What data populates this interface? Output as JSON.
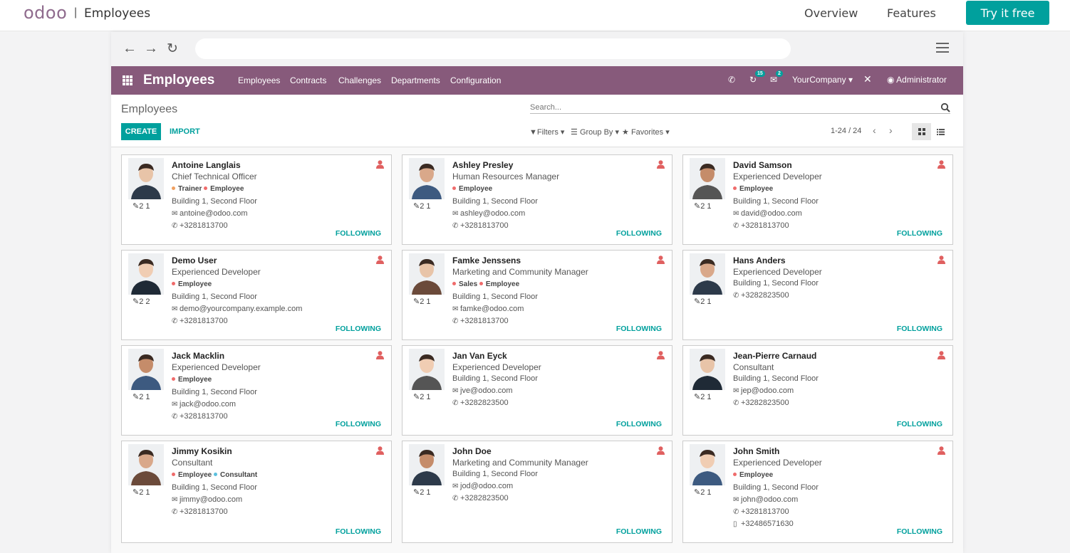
{
  "site": {
    "logo": "odoo",
    "separator": "|",
    "title": "Employees",
    "nav": [
      "Overview",
      "Features"
    ],
    "cta": "Try it free"
  },
  "app": {
    "brand": "Employees",
    "menu": [
      "Employees",
      "Contracts",
      "Challenges",
      "Departments",
      "Configuration"
    ],
    "activity_badge": "15",
    "messages_badge": "2",
    "company": "YourCompany",
    "user": "Administrator",
    "accent": "#875a7b",
    "primary": "#00a09d"
  },
  "control": {
    "breadcrumb": "Employees",
    "search_placeholder": "Search...",
    "create": "CREATE",
    "import": "IMPORT",
    "filters": "Filters",
    "group_by": "Group By",
    "favorites": "Favorites",
    "pager": "1-24 / 24"
  },
  "following_label": "FOLLOWING",
  "employees": [
    {
      "name": "Antoine Langlais",
      "job": "Chief Technical Officer",
      "tags": [
        {
          "label": "Trainer",
          "color": "#f0a060"
        },
        {
          "label": "Employee",
          "color": "#ef6b6b"
        }
      ],
      "location": "Building 1, Second Floor",
      "email": "antoine@odoo.com",
      "phone": "+3281813700",
      "mobile": "",
      "stats": "2  1"
    },
    {
      "name": "Ashley Presley",
      "job": "Human Resources Manager",
      "tags": [
        {
          "label": "Employee",
          "color": "#ef6b6b"
        }
      ],
      "location": "Building 1, Second Floor",
      "email": "ashley@odoo.com",
      "phone": "+3281813700",
      "mobile": "",
      "stats": "2  1"
    },
    {
      "name": "David Samson",
      "job": "Experienced Developer",
      "tags": [
        {
          "label": "Employee",
          "color": "#ef6b6b"
        }
      ],
      "location": "Building 1, Second Floor",
      "email": "david@odoo.com",
      "phone": "+3281813700",
      "mobile": "",
      "stats": "2  1"
    },
    {
      "name": "Demo User",
      "job": "Experienced Developer",
      "tags": [
        {
          "label": "Employee",
          "color": "#ef6b6b"
        }
      ],
      "location": "Building 1, Second Floor",
      "email": "demo@yourcompany.example.com",
      "phone": "+3281813700",
      "mobile": "",
      "stats": "2  2"
    },
    {
      "name": "Famke Jenssens",
      "job": "Marketing and Community Manager",
      "tags": [
        {
          "label": "Sales",
          "color": "#ef6b6b"
        },
        {
          "label": "Employee",
          "color": "#ef6b6b"
        }
      ],
      "location": "Building 1, Second Floor",
      "email": "famke@odoo.com",
      "phone": "+3281813700",
      "mobile": "",
      "stats": "2  1"
    },
    {
      "name": "Hans Anders",
      "job": "Experienced Developer",
      "tags": [],
      "location": "Building 1, Second Floor",
      "email": "",
      "phone": "+3282823500",
      "mobile": "",
      "stats": "2  1"
    },
    {
      "name": "Jack Macklin",
      "job": "Experienced Developer",
      "tags": [
        {
          "label": "Employee",
          "color": "#ef6b6b"
        }
      ],
      "location": "Building 1, Second Floor",
      "email": "jack@odoo.com",
      "phone": "+3281813700",
      "mobile": "",
      "stats": "2  1"
    },
    {
      "name": "Jan Van Eyck",
      "job": "Experienced Developer",
      "tags": [],
      "location": "Building 1, Second Floor",
      "email": "jve@odoo.com",
      "phone": "+3282823500",
      "mobile": "",
      "stats": "2  1"
    },
    {
      "name": "Jean-Pierre Carnaud",
      "job": "Consultant",
      "tags": [],
      "location": "Building 1, Second Floor",
      "email": "jep@odoo.com",
      "phone": "+3282823500",
      "mobile": "",
      "stats": "2  1"
    },
    {
      "name": "Jimmy Kosikin",
      "job": "Consultant",
      "tags": [
        {
          "label": "Employee",
          "color": "#ef6b6b"
        },
        {
          "label": "Consultant",
          "color": "#5bc0de"
        }
      ],
      "location": "Building 1, Second Floor",
      "email": "jimmy@odoo.com",
      "phone": "+3281813700",
      "mobile": "",
      "stats": "2  1"
    },
    {
      "name": "John Doe",
      "job": "Marketing and Community Manager",
      "tags": [],
      "location": "Building 1, Second Floor",
      "email": "jod@odoo.com",
      "phone": "+3282823500",
      "mobile": "",
      "stats": "2  1"
    },
    {
      "name": "John Smith",
      "job": "Experienced Developer",
      "tags": [
        {
          "label": "Employee",
          "color": "#ef6b6b"
        }
      ],
      "location": "Building 1, Second Floor",
      "email": "john@odoo.com",
      "phone": "+3281813700",
      "mobile": "+32486571630",
      "stats": "2  1"
    }
  ]
}
